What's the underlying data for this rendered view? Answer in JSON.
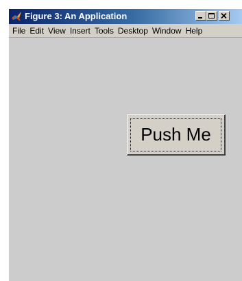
{
  "window": {
    "title": "Figure 3: An Application",
    "icon": "matlab-icon",
    "controls": {
      "minimize": "minimize-icon",
      "maximize": "maximize-icon",
      "close": "close-icon"
    }
  },
  "menubar": {
    "items": [
      {
        "label": "File"
      },
      {
        "label": "Edit"
      },
      {
        "label": "View"
      },
      {
        "label": "Insert"
      },
      {
        "label": "Tools"
      },
      {
        "label": "Desktop"
      },
      {
        "label": "Window"
      },
      {
        "label": "Help"
      }
    ]
  },
  "figure": {
    "button_label": "Push Me"
  },
  "colors": {
    "title_gradient_start": "#0a246a",
    "title_gradient_end": "#a6caf0",
    "window_bg": "#d4d0c8",
    "figure_bg": "#cccccc"
  }
}
